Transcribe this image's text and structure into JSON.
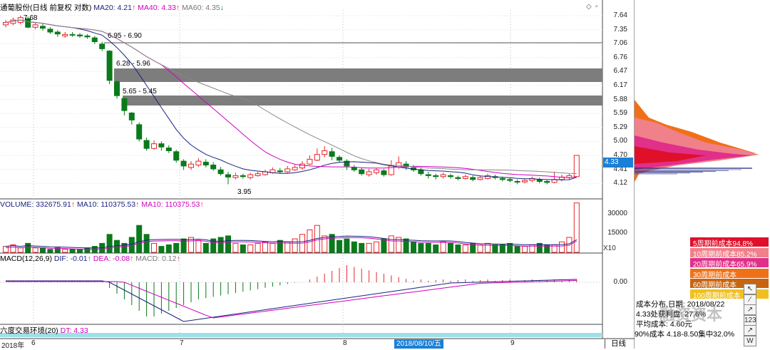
{
  "main_legend": {
    "title": "通葡股份(日线 前复权 对数)",
    "ma20": "MA20: 4.21",
    "ma40": "MA40: 4.33",
    "ma60": "MA60: 4.35"
  },
  "volume_legend": {
    "volume": "VOLUME: 332675.91",
    "ma10a": "MA10: 110375.53",
    "ma10b": "MA10: 110375.53"
  },
  "macd_legend": {
    "title": "MACD(12,26,9)",
    "dif": "DIF: -0.01",
    "dea": "DEA: -0.08",
    "macd": "MACD: 0.12"
  },
  "bottom_legend": {
    "text": "六度交易环境(20)",
    "value": "DT: 4.33"
  },
  "price_axis": [
    "7.64",
    "7.35",
    "7.06",
    "6.76",
    "6.47",
    "6.17",
    "5.88",
    "5.59",
    "5.29",
    "5.00",
    "4.70",
    "4.41",
    "4.12"
  ],
  "current_price_tag": "4.33",
  "volume_axis": [
    "30000",
    "15000"
  ],
  "volume_unit": "X10",
  "macd_axis": "0.00",
  "annotations": {
    "high": "7.68",
    "low": "3.95",
    "gap1": "6.95 - 6.90",
    "gap2": "6.28 - 5.96",
    "gap3": "5.65 - 5.45"
  },
  "time_axis": {
    "year_label": "2018年",
    "m6": "6",
    "m7": "7",
    "m8": "8",
    "m9": "9",
    "cursor_date": "2018/08/10/五",
    "period": "日线"
  },
  "cost_table": [
    {
      "label": "5周期前成本94.8%",
      "color": "#e0102a"
    },
    {
      "label": "10周期前成本85.2%",
      "color": "#f0808a"
    },
    {
      "label": "20周期前成本65.9%",
      "color": "#e0308a"
    },
    {
      "label": "30周期前成本",
      "color": "#f07018"
    },
    {
      "label": "60周期前成本",
      "color": "#c86410"
    },
    {
      "label": "100周期前成本",
      "color": "#f0c020"
    }
  ],
  "chip_info": {
    "line1": "成本分布,日期: 2018/08/22",
    "line2": "4.33处获利盘: 27.6%",
    "line3": "平均成本: 4.60元",
    "line4": "90%成本 4.18-8.50集中32.0%"
  },
  "watermark": "融资资本",
  "tools": [
    "↖",
    "⁄",
    "↗",
    "123",
    "↗",
    "W"
  ],
  "colors": {
    "up": "#e8262b",
    "down": "#0a7a1a",
    "ma20": "#1a237e",
    "ma40": "#d000c0",
    "ma60": "#888888"
  }
}
